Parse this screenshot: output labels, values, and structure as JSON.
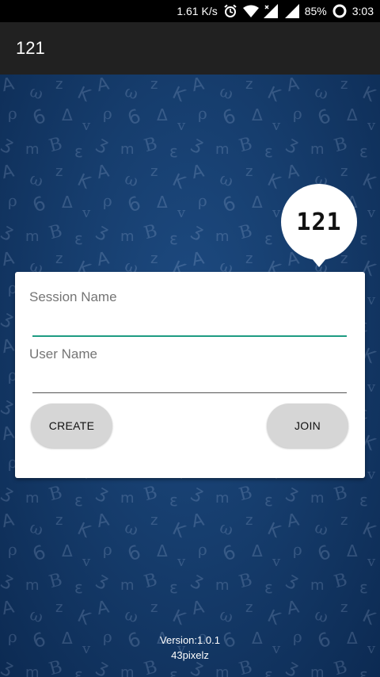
{
  "status_bar": {
    "speed": "1.61 K/s",
    "battery": "85%",
    "time": "3:03",
    "icons": [
      "alarm-icon",
      "wifi-icon",
      "signal-icon",
      "battery-icon"
    ]
  },
  "app_bar": {
    "title": "121"
  },
  "logo": {
    "text": "121"
  },
  "form": {
    "session_label": "Session Name",
    "session_value": "",
    "user_label": "User Name",
    "user_value": "",
    "create_label": "CREATE",
    "join_label": "JOIN"
  },
  "footer": {
    "version": "Version:1.0.1",
    "company": "43pixelz"
  },
  "colors": {
    "app_bar": "#212121",
    "accent": "#1e9c82",
    "background": "#163d6d",
    "button": "#d6d6d6"
  }
}
